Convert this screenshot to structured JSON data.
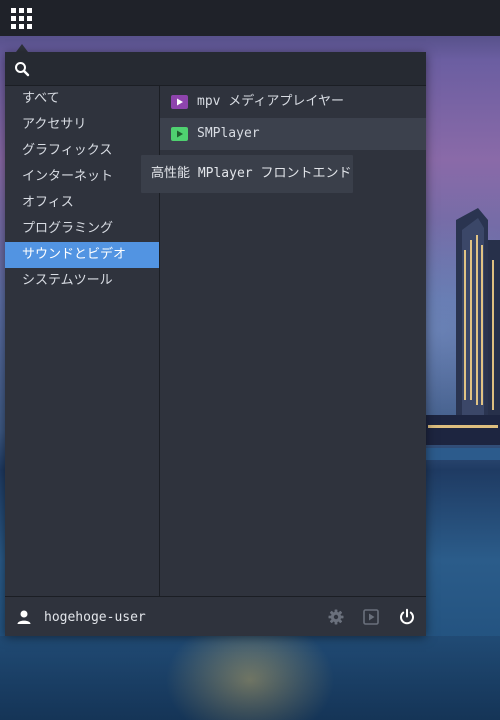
{
  "panel": {
    "apps_button_icon": "app-grid-icon"
  },
  "search": {
    "icon": "search-icon",
    "value": "",
    "placeholder": ""
  },
  "categories": {
    "items": [
      {
        "label": "すべて"
      },
      {
        "label": "アクセサリ"
      },
      {
        "label": "グラフィックス"
      },
      {
        "label": "インターネット"
      },
      {
        "label": "オフィス"
      },
      {
        "label": "プログラミング"
      },
      {
        "label": "サウンドとビデオ"
      },
      {
        "label": "システムツール"
      }
    ],
    "selected": "サウンドとビデオ"
  },
  "apps": {
    "items": [
      {
        "label": "mpv メディアプレイヤー",
        "icon": "mpv-icon",
        "color": "#8e44ad"
      },
      {
        "label": "SMPlayer",
        "icon": "smplayer-icon",
        "color": "#4fd170"
      }
    ],
    "hovered": "SMPlayer"
  },
  "tooltip": {
    "text": "高性能 MPlayer フロントエンド"
  },
  "footer": {
    "user_icon": "user-icon",
    "username": "hogehoge-user",
    "buttons": [
      "settings-icon",
      "media-icon",
      "power-icon"
    ]
  },
  "colors": {
    "accent": "#5294e2",
    "menu_bg": "#2f333d",
    "panel_bg": "#1f2229"
  }
}
